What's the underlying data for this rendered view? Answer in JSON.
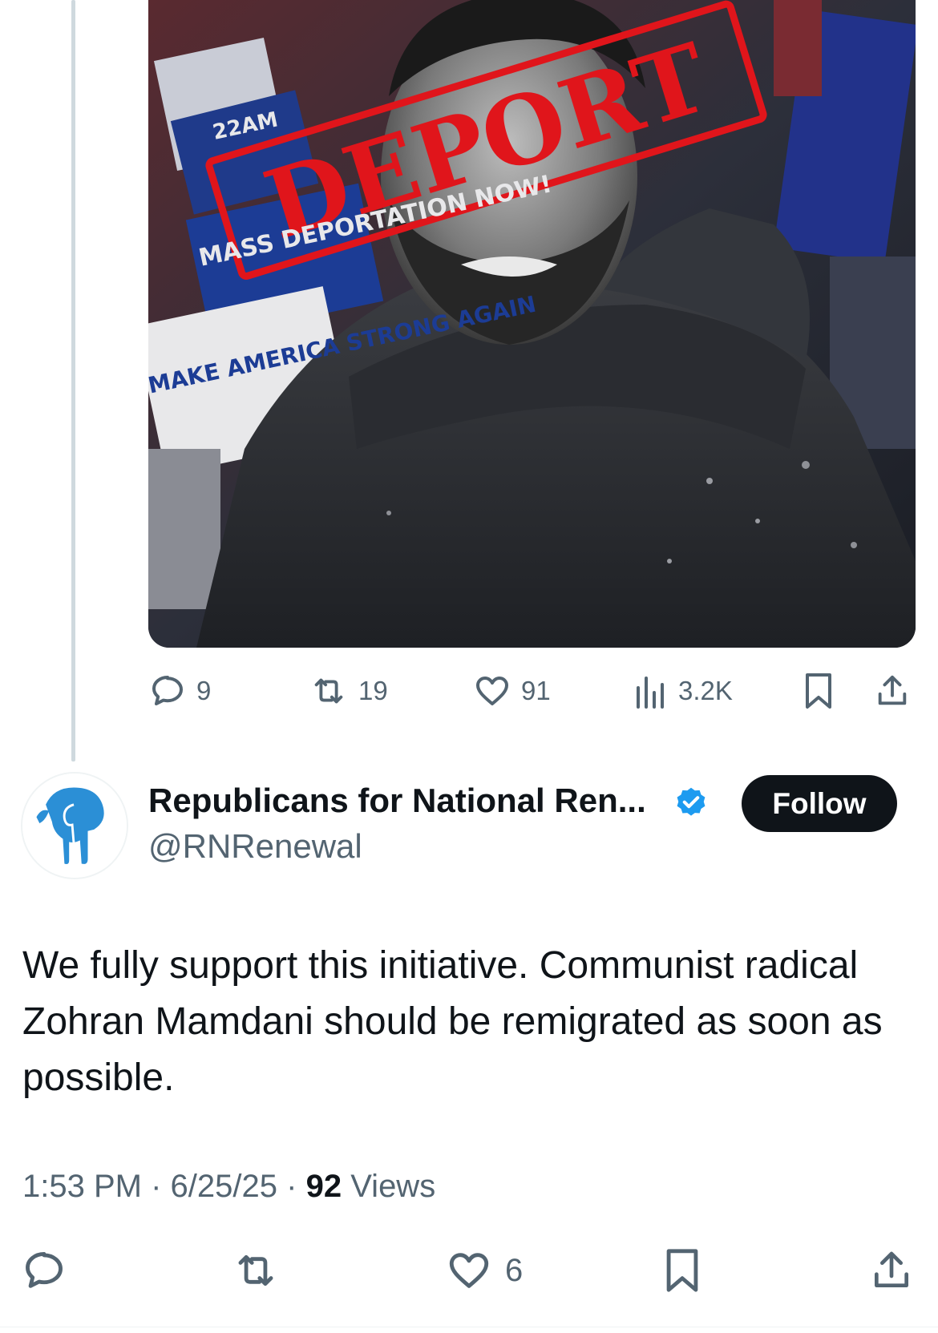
{
  "quoted_tweet": {
    "image": {
      "stamp_text": "DEPORT",
      "sign_texts": [
        "MASS DEPORTATION NOW!",
        "MAKE AMERICA STRONG AGAIN",
        "22AM"
      ]
    },
    "actions": {
      "replies": "9",
      "retweets": "19",
      "likes": "91",
      "views": "3.2K"
    }
  },
  "tweet": {
    "author": {
      "display_name": "Republicans for National Ren...",
      "handle": "@RNRenewal",
      "verified": true
    },
    "follow_label": "Follow",
    "text": "We fully support this initiative. Communist radical Zohran Mamdani should be remigrated as soon as possible.",
    "time": "1:53 PM",
    "date": "6/25/25",
    "views_count": "92",
    "views_label": "Views",
    "separator": "·",
    "actions": {
      "likes": "6"
    }
  },
  "colors": {
    "text_primary": "#0f1419",
    "text_secondary": "#536471",
    "verified_blue": "#1d9bf0",
    "stamp_red": "#e0151b",
    "elephant_blue": "#2b8fd6"
  },
  "icons": {
    "reply": "speech-bubble-icon",
    "retweet": "retweet-arrows-icon",
    "like": "heart-icon",
    "views": "bar-chart-icon",
    "bookmark": "bookmark-icon",
    "share": "share-upload-icon",
    "verified": "verified-badge-icon",
    "avatar": "elephant-logo-icon"
  }
}
